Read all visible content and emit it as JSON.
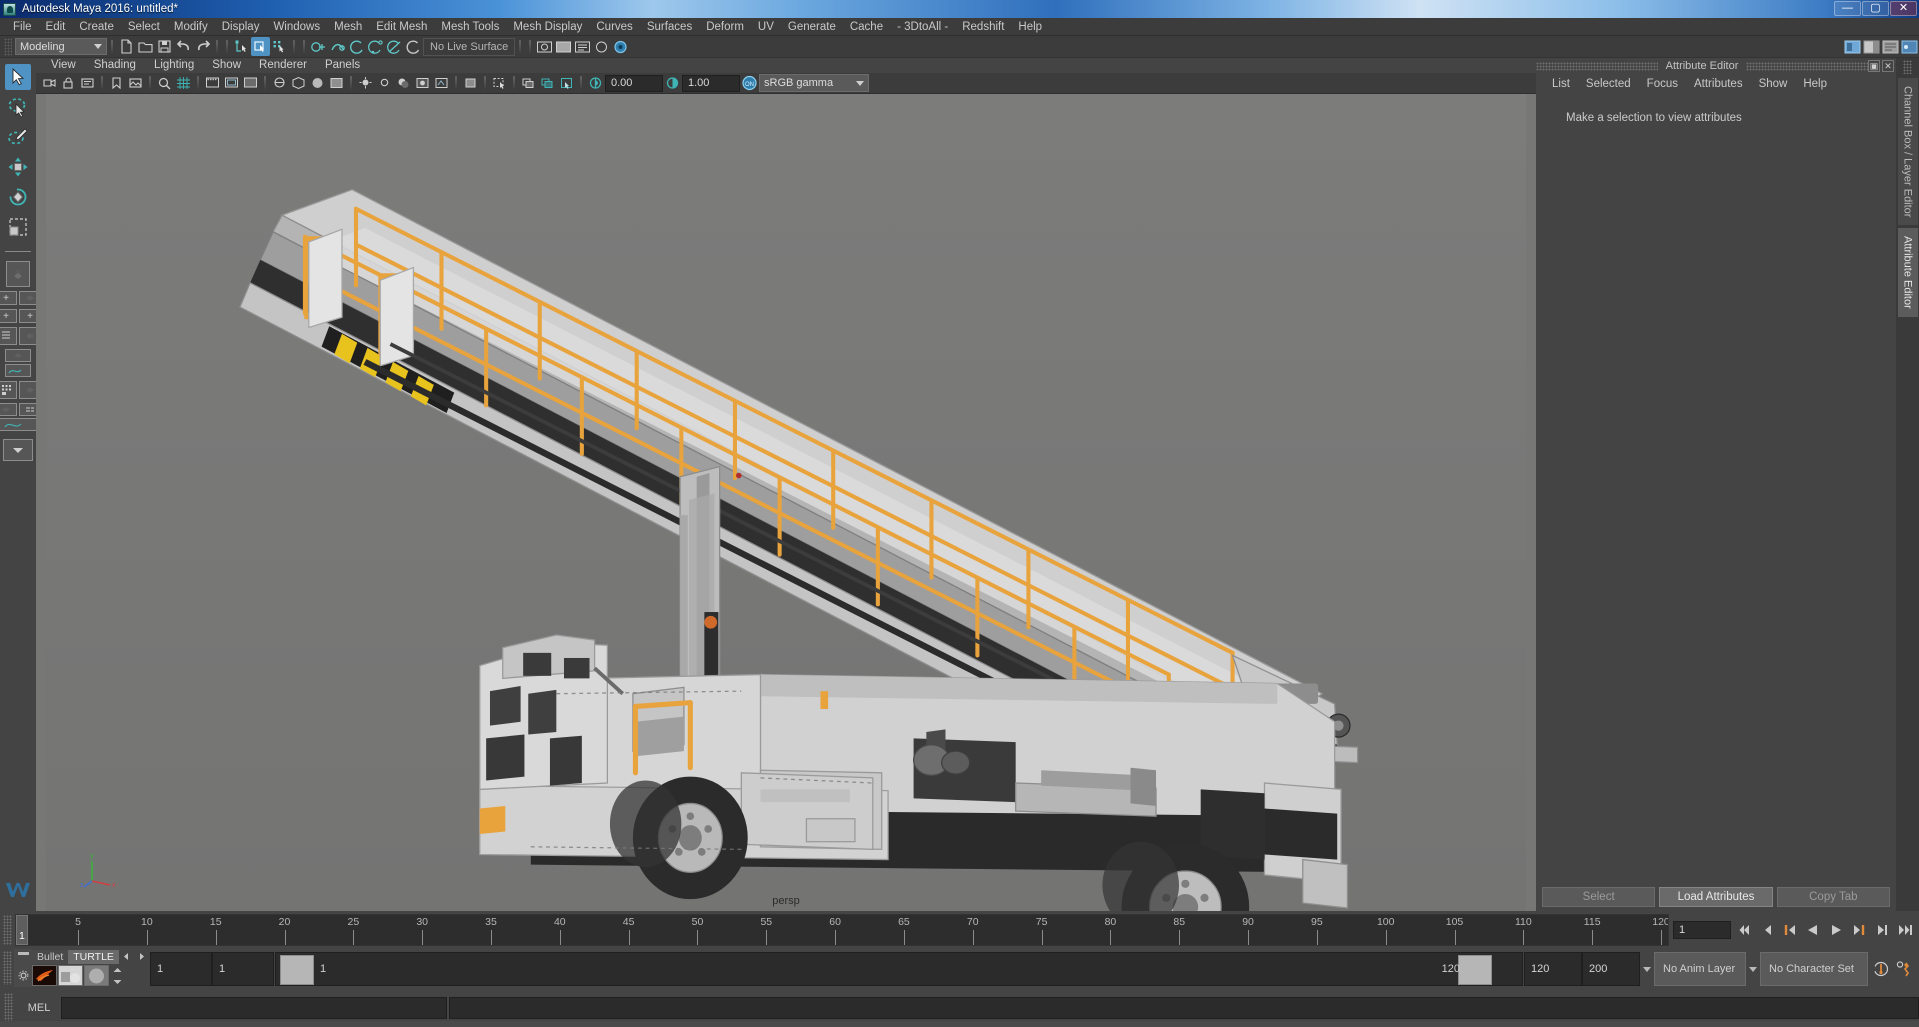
{
  "window": {
    "title": "Autodesk Maya 2016: untitled*",
    "app_icon": "maya-icon",
    "buttons": {
      "minimize": "—",
      "maximize": "▢",
      "close": "✕"
    }
  },
  "menubar": {
    "items": [
      "File",
      "Edit",
      "Create",
      "Select",
      "Modify",
      "Display",
      "Windows",
      "Mesh",
      "Edit Mesh",
      "Mesh Tools",
      "Mesh Display",
      "Curves",
      "Surfaces",
      "Deform",
      "UV",
      "Generate",
      "Cache",
      "- 3DtoAll -",
      "Redshift",
      "Help"
    ]
  },
  "statusline": {
    "menuset": "Modeling",
    "live_surface": "No Live Surface",
    "file_icons": [
      "new-scene-icon",
      "open-scene-icon",
      "save-scene-icon",
      "undo-icon",
      "redo-icon"
    ],
    "selmode_icons": [
      "select-by-hierarchy-icon",
      "select-by-object-icon",
      "select-by-component-icon"
    ],
    "snap_icons": [
      "snap-to-grid-icon",
      "snap-to-curve-icon",
      "snap-to-point-icon",
      "snap-to-projected-center-icon",
      "snap-to-view-plane-icon",
      "make-live-icon"
    ],
    "right_icons": [
      "show-editor-icon",
      "channel-box-icon",
      "attribute-editor-icon",
      "tool-settings-icon"
    ]
  },
  "viewport": {
    "menus": [
      "View",
      "Shading",
      "Lighting",
      "Show",
      "Renderer",
      "Panels"
    ],
    "camera_label": "persp",
    "toolbar": {
      "exposure_value": "0.00",
      "gamma_value": "1.00",
      "color_management": "sRGB gamma",
      "cm_toggle": "ON",
      "icons": [
        "select-camera-icon",
        "lock-camera-icon",
        "camera-attributes-icon",
        "bookmark-icon",
        "image-plane-icon",
        "two-d-pan-zoom-icon",
        "grid-toggle-icon",
        "film-gate-icon",
        "resolution-gate-icon",
        "gate-mask-icon",
        "xray-icon",
        "xray-joints-icon",
        "wireframe-icon",
        "smooth-shade-icon",
        "shaded-textured-icon",
        "lights-icon",
        "shadows-icon",
        "aa-icon",
        "ao-icon",
        "motion-blur-icon",
        "exposure-icon",
        "gamma-icon"
      ]
    },
    "axis_gizmo": {
      "x": "x",
      "y": "y",
      "z": "z"
    },
    "subject": "airport passenger boarding stairs vehicle (untextured grey model with orange railings)"
  },
  "toolbox": {
    "items": [
      {
        "name": "select-tool",
        "selected": true
      },
      {
        "name": "lasso-select-tool",
        "selected": false
      },
      {
        "name": "paint-select-tool",
        "selected": false
      },
      {
        "name": "move-tool",
        "selected": false
      },
      {
        "name": "rotate-tool",
        "selected": false
      },
      {
        "name": "scale-tool",
        "selected": false
      }
    ],
    "layouts": [
      {
        "name": "single-perspective-view"
      },
      {
        "name": "four-view"
      },
      {
        "name": "persp-outliner"
      },
      {
        "name": "persp-graph-editor"
      },
      {
        "name": "hypershade-persp"
      },
      {
        "name": "persp-graph-outliner"
      },
      {
        "name": "more-layouts"
      }
    ]
  },
  "attribute_editor": {
    "panel_title": "Attribute Editor",
    "window_buttons": [
      "undock-icon",
      "close-icon"
    ],
    "menus": [
      "List",
      "Selected",
      "Focus",
      "Attributes",
      "Show",
      "Help"
    ],
    "message": "Make a selection to view attributes",
    "buttons": [
      {
        "label": "Select",
        "active": false
      },
      {
        "label": "Load Attributes",
        "active": true
      },
      {
        "label": "Copy Tab",
        "active": false
      }
    ]
  },
  "right_tabs": [
    {
      "label": "Channel Box / Layer Editor",
      "selected": false
    },
    {
      "label": "Attribute Editor",
      "selected": true
    }
  ],
  "timeline": {
    "start": 1,
    "end": 120,
    "current_frame": "1",
    "tick_labels": [
      "5",
      "10",
      "15",
      "20",
      "25",
      "30",
      "35",
      "40",
      "45",
      "50",
      "55",
      "60",
      "65",
      "70",
      "75",
      "80",
      "85",
      "90",
      "95",
      "100",
      "105",
      "110",
      "115",
      "120"
    ],
    "current_frame_field": "1",
    "playback_buttons": [
      "go-to-start-icon",
      "step-back-keyframe-icon",
      "step-back-frame-icon",
      "play-backwards-icon",
      "play-forwards-icon",
      "step-forward-frame-icon",
      "step-forward-keyframe-icon",
      "go-to-end-icon"
    ]
  },
  "range_slider": {
    "shelf_tabs": [
      {
        "label": "Bullet",
        "selected": false
      },
      {
        "label": "TURTLE",
        "selected": true
      }
    ],
    "shelf_arrows": [
      "prev-shelf-icon",
      "next-shelf-icon"
    ],
    "shelf_items": [
      "turtle-bake-icon",
      "turtle-render-icon",
      "turtle-material-icon"
    ],
    "anim_start": "1",
    "range_start": "1",
    "range_in": "1",
    "range_out": "120",
    "range_end": "120",
    "anim_end": "200",
    "anim_layer": "No Anim Layer",
    "character_set": "No Character Set",
    "right_icons": [
      "auto-key-icon",
      "animation-preferences-icon"
    ]
  },
  "command_line": {
    "language": "MEL",
    "input_value": "",
    "input_placeholder": "",
    "output_value": ""
  },
  "colors": {
    "accent_blue": "#4f92c4",
    "panel_bg": "#444444",
    "field_bg": "#2b2b2b",
    "viewport_bg": "#777776",
    "highlight_orange": "#e8a33d"
  }
}
